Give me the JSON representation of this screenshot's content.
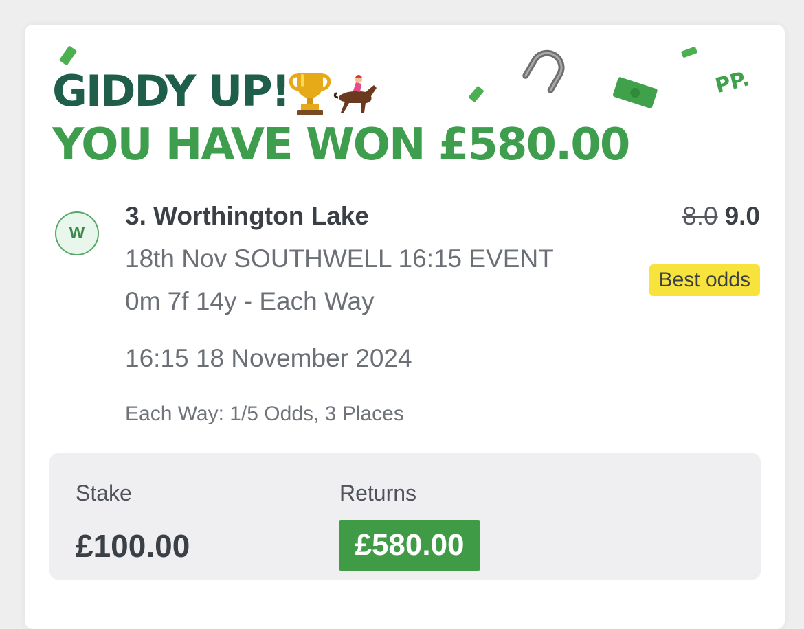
{
  "banner": {
    "line1": "GIDDY UP!",
    "line2": "YOU HAVE WON £580.00",
    "corner_text": "PP."
  },
  "icons": [
    "trophy-icon",
    "jockey-icon",
    "horseshoe-icon",
    "money-confetti-icon"
  ],
  "selection": {
    "badge": "W",
    "name": "3. Worthington Lake",
    "meeting": "18th Nov SOUTHWELL 16:15 EVENT",
    "distance_market": "0m 7f 14y - Each Way",
    "datetime": "16:15 18 November 2024",
    "each_way_terms": "Each Way: 1/5 Odds, 3 Places",
    "old_odds": "8.0",
    "new_odds": "9.0",
    "best_odds_label": "Best odds"
  },
  "summary": {
    "stake_label": "Stake",
    "stake_value": "£100.00",
    "returns_label": "Returns",
    "returns_value": "£580.00"
  },
  "colors": {
    "headline_dark_green": "#1e5e4a",
    "headline_green": "#3f9e4d",
    "returns_green": "#3f9b45",
    "best_odds_yellow": "#f7e33c",
    "summary_background": "#efeff2"
  }
}
